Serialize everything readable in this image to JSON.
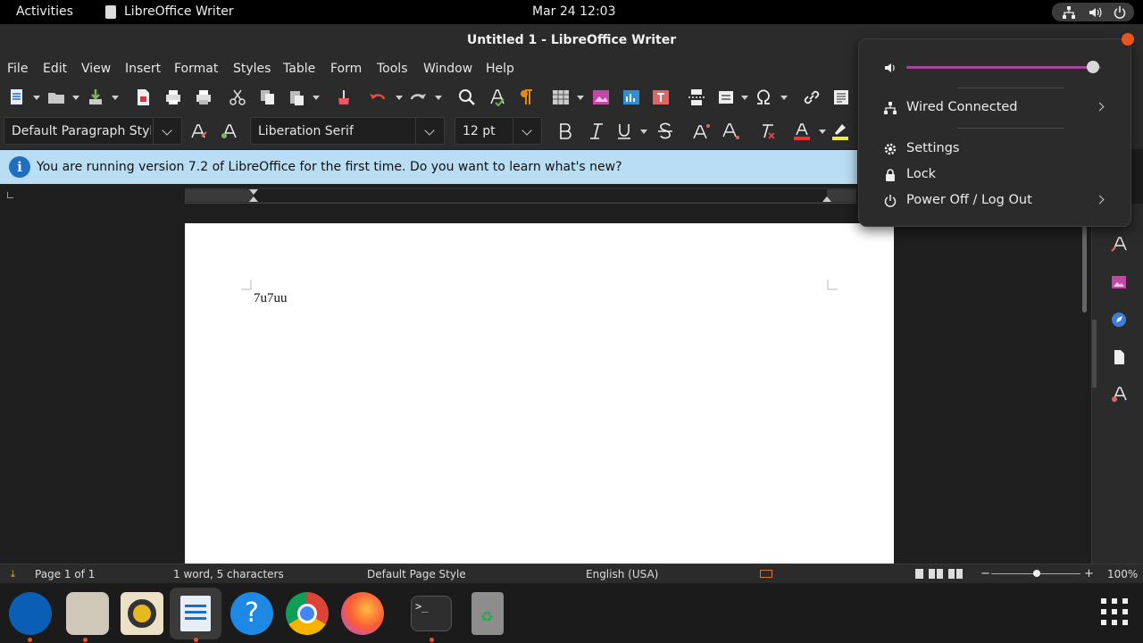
{
  "topbar": {
    "activities": "Activities",
    "app_name": "LibreOffice Writer",
    "datetime": "Mar 24  12:03"
  },
  "window": {
    "title": "Untitled 1 - LibreOffice Writer"
  },
  "menubar": {
    "items": [
      "File",
      "Edit",
      "View",
      "Insert",
      "Format",
      "Styles",
      "Table",
      "Form",
      "Tools",
      "Window",
      "Help"
    ]
  },
  "formatting": {
    "paragraph_style": "Default Paragraph Styl",
    "font_name": "Liberation Serif",
    "font_size": "12 pt"
  },
  "infobar": {
    "message": "You are running version 7.2 of LibreOffice for the first time. Do you want to learn what's new?",
    "icon": "info-icon"
  },
  "document": {
    "text": "7u7uu"
  },
  "statusbar": {
    "page": "Page 1 of 1",
    "word_count": "1 word, 5 characters",
    "page_style": "Default Page Style",
    "language": "English (USA)",
    "zoom": "100%"
  },
  "system_menu": {
    "volume_level": 0.96,
    "network": "Wired Connected",
    "settings": "Settings",
    "lock": "Lock",
    "power": "Power Off / Log Out"
  },
  "colors": {
    "accent": "#e95420",
    "volume_track": "#a6459b",
    "infobar_bg": "#b9ddf3"
  }
}
